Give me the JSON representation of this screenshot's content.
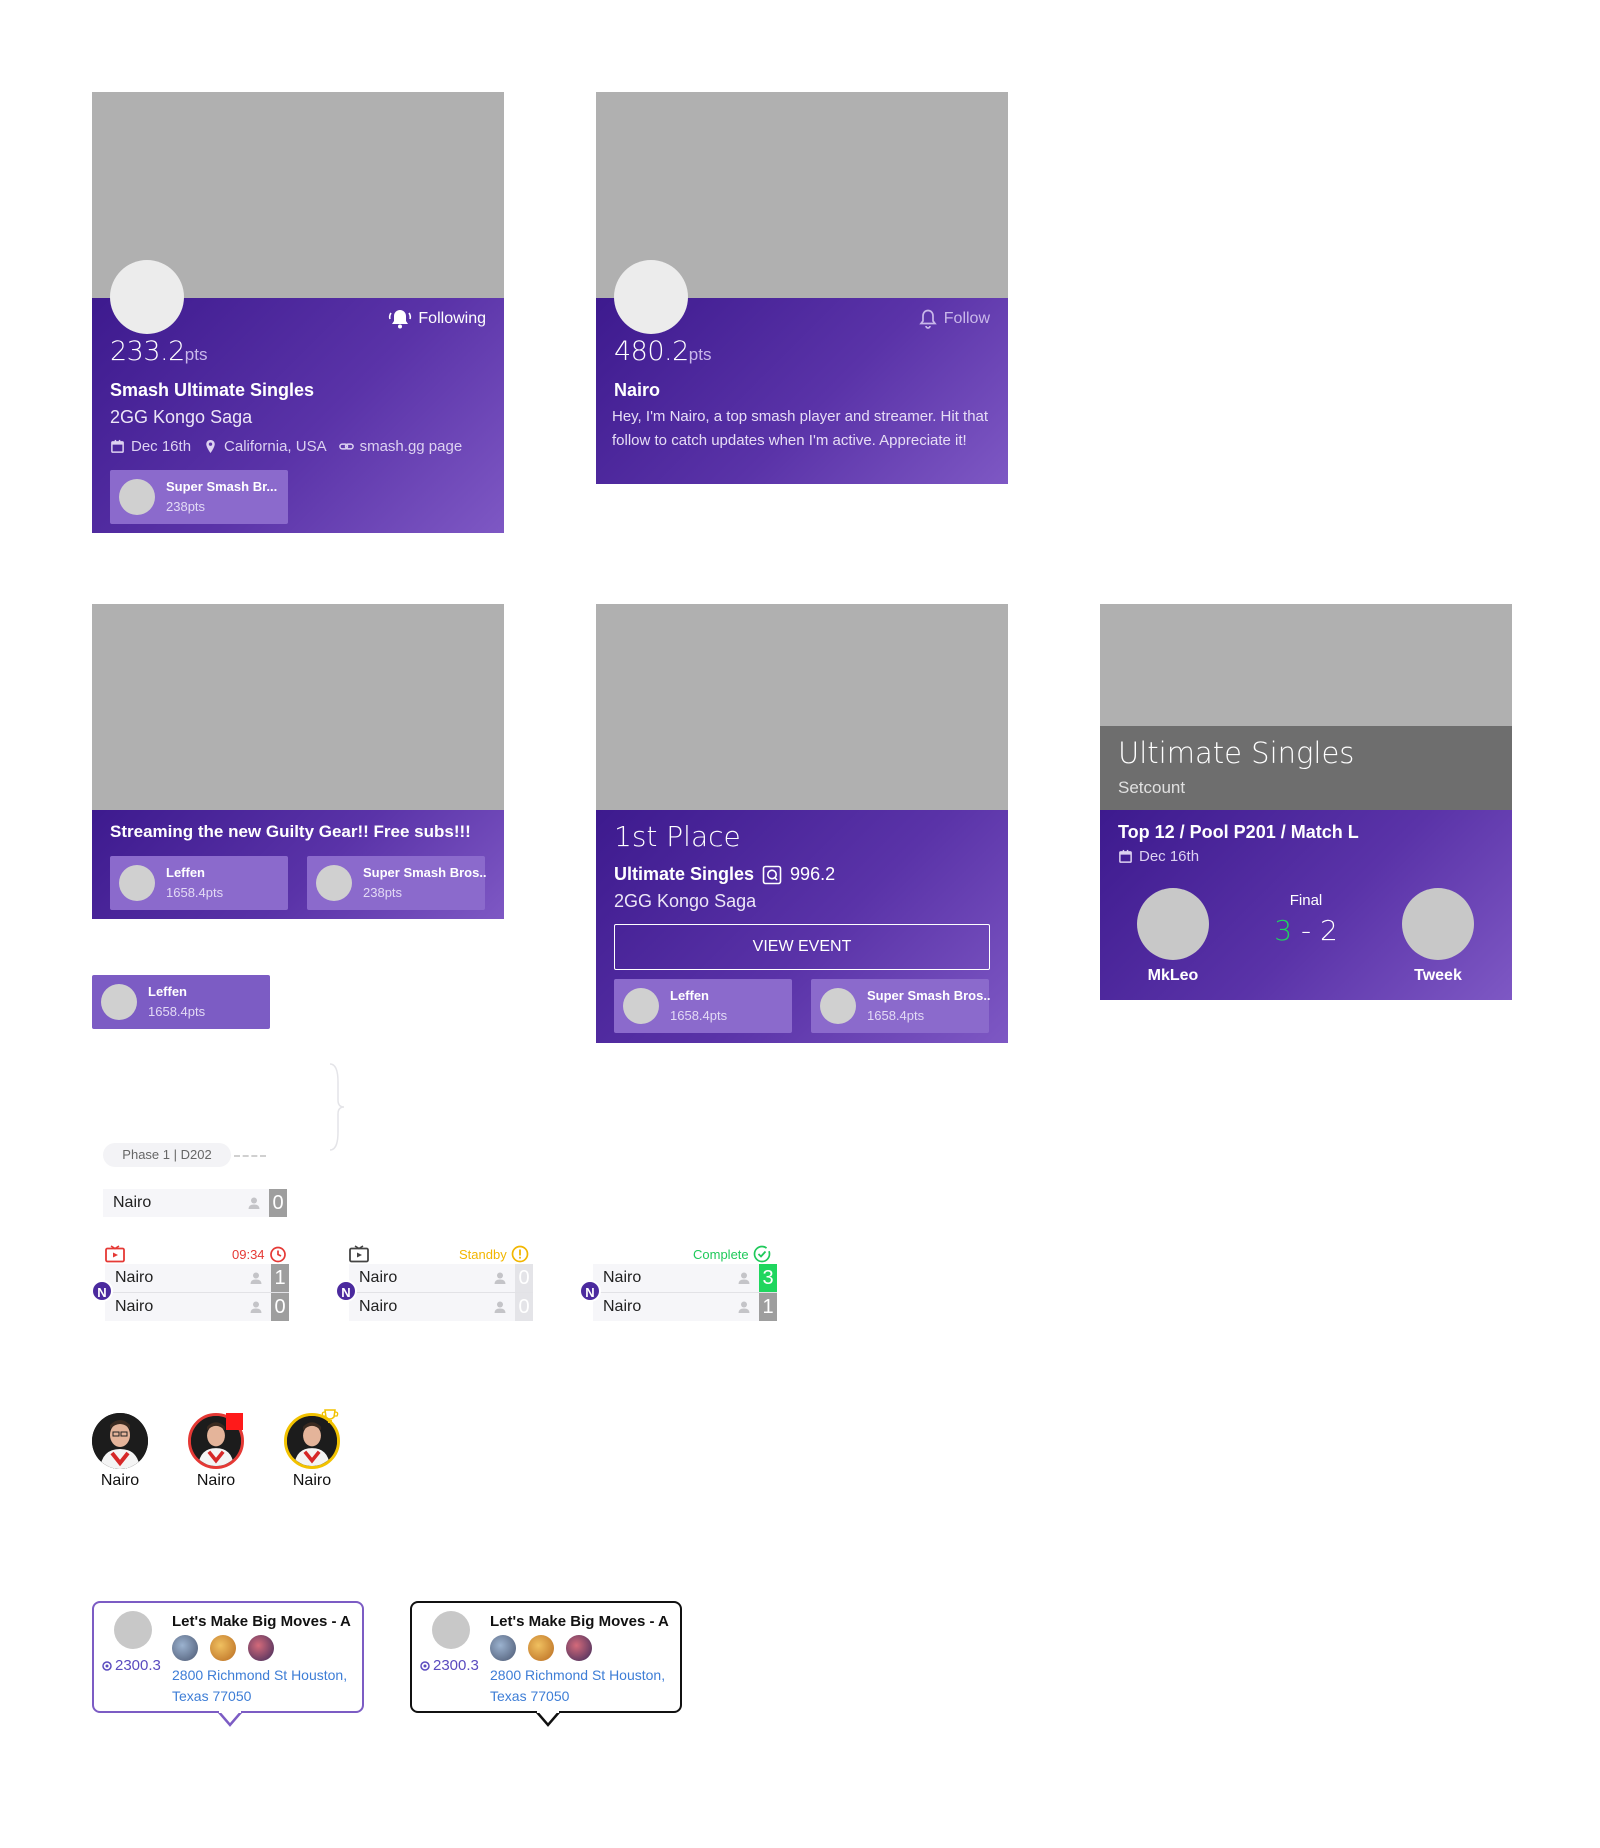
{
  "card1": {
    "follow_label": "Following",
    "points": "233.2",
    "points_unit": "pts",
    "title": "Smash Ultimate Singles",
    "subtitle": "2GG Kongo Saga",
    "date": "Dec 16th",
    "location": "California, USA",
    "link": "smash.gg page",
    "chip": {
      "name": "Super Smash Br...",
      "pts": "238pts"
    }
  },
  "card2": {
    "follow_label": "Follow",
    "points": "480.2",
    "points_unit": "pts",
    "name": "Nairo",
    "bio": "Hey, I'm Nairo, a top smash player and streamer. Hit that follow to catch updates when I'm active. Appreciate it!"
  },
  "card3": {
    "title": "Streaming the new Guilty Gear!! Free subs!!!",
    "chips": [
      {
        "name": "Leffen",
        "pts": "1658.4pts"
      },
      {
        "name": "Super Smash Bros..",
        "pts": "238pts"
      }
    ]
  },
  "card4": {
    "place": "1st Place",
    "event": "Ultimate Singles",
    "score": "996.2",
    "subtitle": "2GG Kongo Saga",
    "button": "VIEW EVENT",
    "chips": [
      {
        "name": "Leffen",
        "pts": "1658.4pts"
      },
      {
        "name": "Super Smash Bros..",
        "pts": "1658.4pts"
      }
    ]
  },
  "card5": {
    "header_title": "Ultimate Singles",
    "header_sub": "Setcount",
    "match": "Top 12 / Pool P201 / Match L",
    "date": "Dec 16th",
    "final_label": "Final",
    "score_left": "3",
    "score_dash": "-",
    "score_right": "2",
    "player_left": "MkLeo",
    "player_right": "Tweek"
  },
  "standalone_chip": {
    "name": "Leffen",
    "pts": "1658.4pts"
  },
  "bracket": {
    "phase": "Phase 1 | D202",
    "single_slot": {
      "name": "Nairo",
      "score": "0"
    },
    "matches": [
      {
        "status": "09:34",
        "status_color": "#e53935",
        "rows": [
          {
            "name": "Nairo",
            "score": "1",
            "score_bg": "#9e9e9e"
          },
          {
            "name": "Nairo",
            "score": "0",
            "score_bg": "#9e9e9e"
          }
        ]
      },
      {
        "status": "Standby",
        "status_color": "#f2b600",
        "rows": [
          {
            "name": "Nairo",
            "score": "0",
            "score_bg": "#e4e4e8"
          },
          {
            "name": "Nairo",
            "score": "0",
            "score_bg": "#e4e4e8"
          }
        ]
      },
      {
        "status": "Complete",
        "status_color": "#1fc95a",
        "rows": [
          {
            "name": "Nairo",
            "score": "3",
            "score_bg": "#1fd65e"
          },
          {
            "name": "Nairo",
            "score": "1",
            "score_bg": "#9e9e9e"
          }
        ]
      }
    ],
    "badge_letter": "N"
  },
  "players": [
    {
      "name": "Nairo",
      "ring": "none"
    },
    {
      "name": "Nairo",
      "ring": "#e53935"
    },
    {
      "name": "Nairo",
      "ring": "#f2c200"
    }
  ],
  "map_cards": [
    {
      "title": "Let's Make Big Moves - A",
      "pts": "2300.3",
      "address": "2800 Richmond St Houston, Texas 77050",
      "border": "#7c5cc4"
    },
    {
      "title": "Let's Make Big Moves - A",
      "pts": "2300.3",
      "address": "2800 Richmond St Houston, Texas 77050",
      "border": "#111111"
    }
  ],
  "colors": {
    "purple_dark": "#3d1a8e",
    "purple_light": "#7e58c4",
    "score_green": "#1fd65e"
  }
}
